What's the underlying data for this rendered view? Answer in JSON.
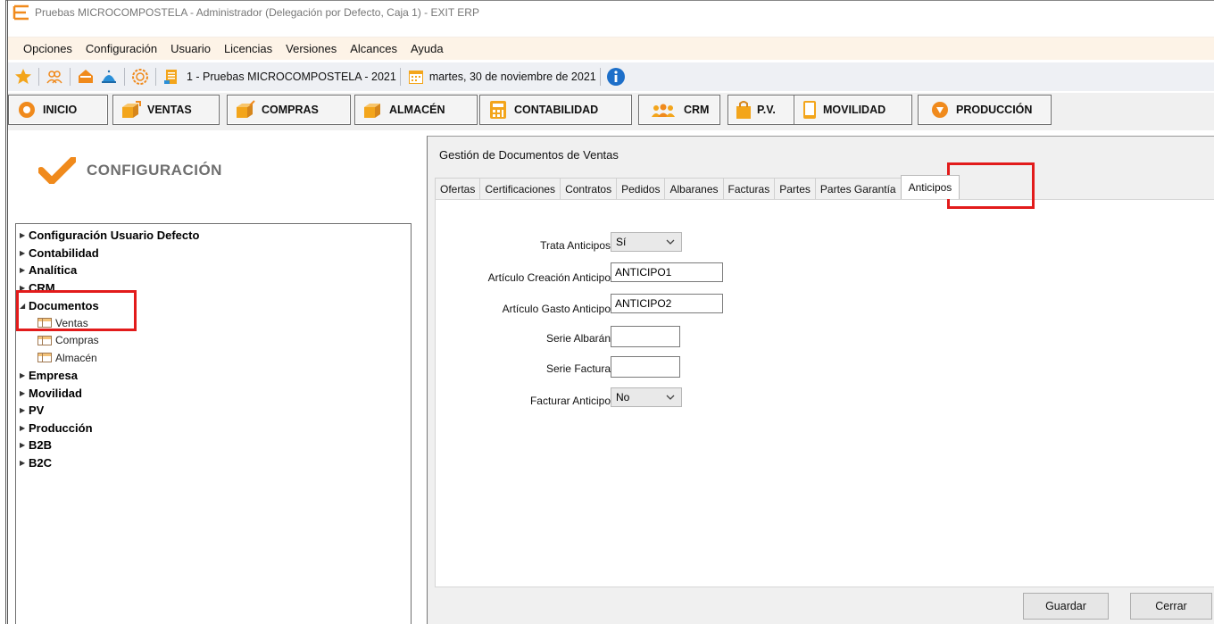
{
  "window": {
    "title": "Pruebas MICROCOMPOSTELA - Administrador (Delegación por Defecto, Caja 1) - EXIT ERP"
  },
  "menu": [
    "Opciones",
    "Configuración",
    "Usuario",
    "Licencias",
    "Versiones",
    "Alcances",
    "Ayuda"
  ],
  "toolbar": {
    "company": "1 - Pruebas MICROCOMPOSTELA - 2021",
    "date": "martes, 30 de noviembre de 2021"
  },
  "modules": [
    "INICIO",
    "VENTAS",
    "COMPRAS",
    "ALMACÉN",
    "CONTABILIDAD",
    "CRM",
    "P.V.",
    "MOVILIDAD",
    "PRODUCCIÓN"
  ],
  "config": {
    "title": "CONFIGURACIÓN",
    "tree": [
      {
        "label": "Configuración Usuario Defecto"
      },
      {
        "label": "Contabilidad"
      },
      {
        "label": "Analítica"
      },
      {
        "label": "CRM"
      },
      {
        "label": "Documentos",
        "children": [
          "Ventas",
          "Compras",
          "Almacén"
        ]
      },
      {
        "label": "Empresa"
      },
      {
        "label": "Movilidad"
      },
      {
        "label": "PV"
      },
      {
        "label": "Producción"
      },
      {
        "label": "B2B"
      },
      {
        "label": "B2C"
      }
    ]
  },
  "dialog": {
    "title": "Gestión de Documentos de Ventas",
    "tabs": [
      "Ofertas",
      "Certificaciones",
      "Contratos",
      "Pedidos",
      "Albaranes",
      "Facturas",
      "Partes",
      "Partes Garantía",
      "Anticipos"
    ],
    "active_tab": "Anticipos",
    "fields": {
      "trata_label": "Trata Anticipos",
      "trata_value": "Sí",
      "art_creacion_label": "Artículo Creación Anticipo",
      "art_creacion_value": "ANTICIPO1",
      "art_gasto_label": "Artículo Gasto Anticipo",
      "art_gasto_value": "ANTICIPO2",
      "serie_albaran_label": "Serie Albarán",
      "serie_albaran_value": "",
      "serie_factura_label": "Serie Factura",
      "serie_factura_value": "",
      "facturar_label": "Facturar Anticipo",
      "facturar_value": "No"
    },
    "buttons": {
      "save": "Guardar",
      "close": "Cerrar"
    }
  },
  "colors": {
    "accent_orange": "#f08a1c",
    "highlight_red": "#e21b1b",
    "menubar_bg": "#fdf3e7",
    "toolbar_bg": "#eef0f4"
  }
}
